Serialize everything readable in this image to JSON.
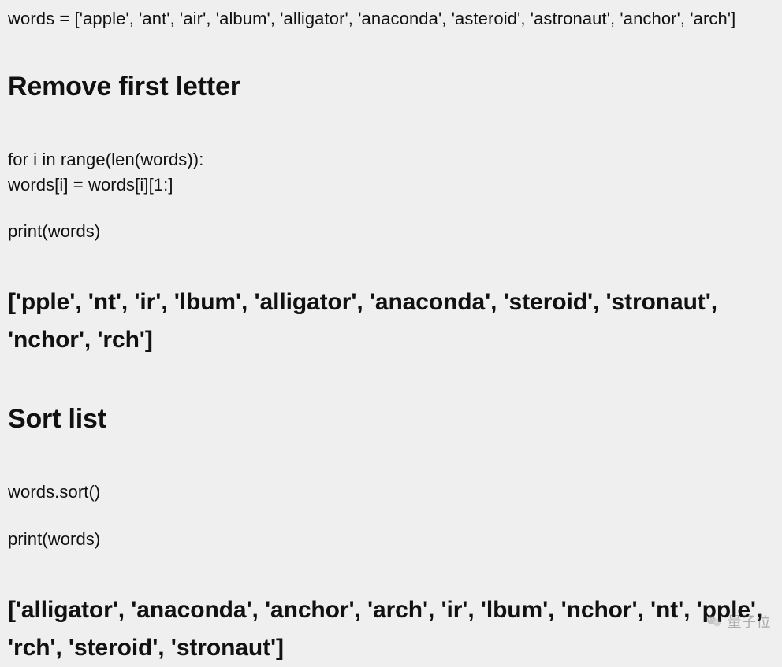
{
  "top_code": "words = ['apple', 'ant', 'air', 'album', 'alligator', 'anaconda', 'asteroid', 'astronaut', 'anchor', 'arch']",
  "section1": {
    "heading": "Remove first letter",
    "code_line1": "for i in range(len(words)):",
    "code_line2": "words[i] = words[i][1:]",
    "code_line3": "print(words)",
    "output": "['pple', 'nt', 'ir', 'lbum', 'alligator', 'anaconda', 'steroid', 'stronaut', 'nchor', 'rch']"
  },
  "section2": {
    "heading": "Sort list",
    "code_line1": "words.sort()",
    "code_line2": "print(words)",
    "output": "['alligator', 'anaconda', 'anchor',  'arch', 'ir',  'lbum', 'nchor', 'nt', 'pple', 'rch', 'steroid', 'stronaut']"
  },
  "watermark": {
    "label": "量子位"
  }
}
